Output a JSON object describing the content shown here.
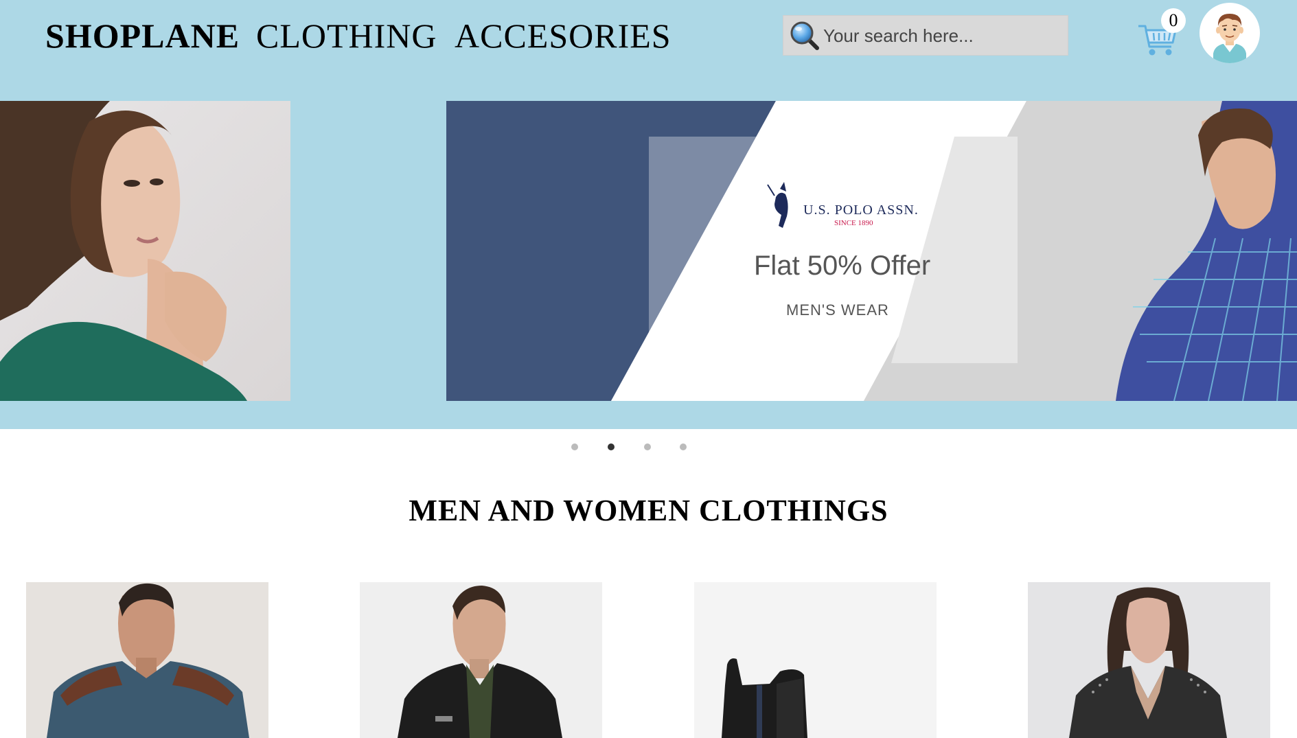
{
  "nav": {
    "brand": "SHOPLANE",
    "clothing": "CLOTHING",
    "accessories": "ACCESORIES"
  },
  "search": {
    "placeholder": "Your search here..."
  },
  "cart": {
    "count": "0",
    "icon": "cart-icon"
  },
  "user": {
    "icon": "user-avatar-icon"
  },
  "carousel": {
    "slides_count": 4,
    "active_slide": 1,
    "promo": {
      "logo_text": "U.S. POLO ASSN.",
      "logo_since": "SINCE 1890",
      "offer": "Flat 50% Offer",
      "subtitle": "MEN'S WEAR"
    }
  },
  "section": {
    "title": "MEN AND WOMEN CLOTHINGS"
  },
  "colors": {
    "header_bg": "#add8e6",
    "promo_navy": "#40557b",
    "active_dot": "#333333",
    "inactive_dot": "#bbbbbb"
  }
}
